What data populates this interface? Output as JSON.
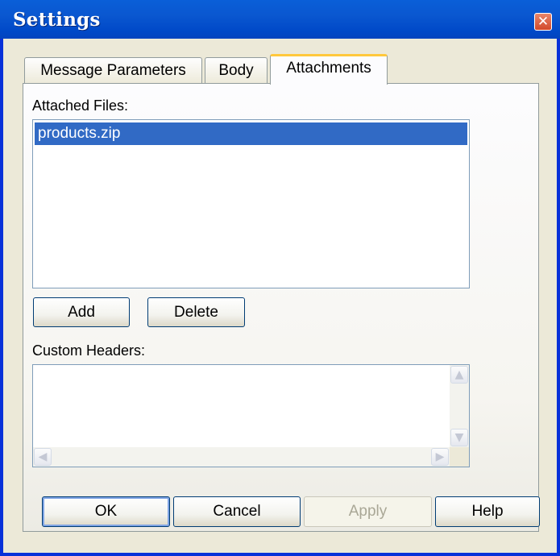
{
  "window": {
    "title": "Settings",
    "close_glyph": "✕"
  },
  "tabs": [
    {
      "label": "Message Parameters",
      "active": false
    },
    {
      "label": "Body",
      "active": false
    },
    {
      "label": "Attachments",
      "active": true
    }
  ],
  "attachments": {
    "files_label": "Attached Files:",
    "files": [
      "products.zip"
    ],
    "selected_file": "products.zip",
    "add_label": "Add",
    "delete_label": "Delete",
    "headers_label": "Custom Headers:"
  },
  "scrollbar": {
    "up": "▲",
    "down": "▼",
    "left": "◀",
    "right": "▶"
  },
  "buttons": {
    "ok": "OK",
    "cancel": "Cancel",
    "apply": "Apply",
    "help": "Help"
  },
  "colors": {
    "titlebar": "#0a5fd8",
    "selection": "#316ac5",
    "active_tab_accent": "#ffc83c",
    "dialog_bg": "#ece9d8"
  }
}
